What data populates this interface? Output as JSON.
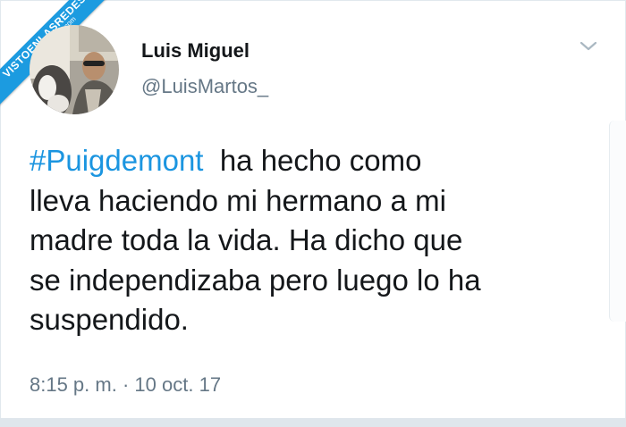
{
  "watermark": {
    "text": "VISTOENLASREDES",
    "sub": ".com",
    "color": "#1c9be0"
  },
  "tweet": {
    "author": {
      "display_name": "Luis Miguel",
      "handle": "@LuisMartos_"
    },
    "menu_icon": "chevron-down-icon",
    "hashtag": "#Puigdemont",
    "text_lines": [
      "ha hecho como",
      "lleva haciendo mi hermano a mi",
      "madre toda la vida. Ha dicho que",
      "se independizaba pero luego lo ha",
      "suspendido."
    ],
    "time": "8:15 p. m.",
    "separator": "·",
    "date": "10 oct. 17"
  },
  "colors": {
    "link": "#1b95e0",
    "text": "#14171a",
    "secondary": "#657786"
  }
}
